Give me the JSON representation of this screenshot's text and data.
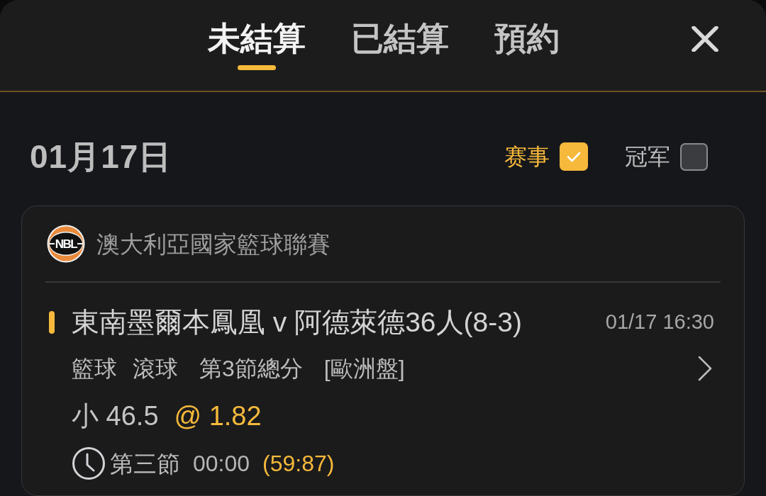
{
  "tabs": [
    {
      "label": "未結算",
      "selected": true
    },
    {
      "label": "已結算",
      "selected": false
    },
    {
      "label": "預約",
      "selected": false
    }
  ],
  "date_header": {
    "date": "01月17日",
    "filters": [
      {
        "label": "赛事",
        "checked": true
      },
      {
        "label": "冠军",
        "checked": false
      }
    ]
  },
  "bet_card": {
    "league": {
      "logo_text": "NBL",
      "name": "澳大利亞國家籃球聯賽"
    },
    "match": "東南墨爾本鳳凰 v 阿德萊德36人(8-3)",
    "time": "01/17 16:30",
    "details": [
      "籃球",
      "滾球",
      "第3節總分",
      "[歐洲盤]"
    ],
    "selection": "小 46.5",
    "odds": "@ 1.82",
    "period": "第三節",
    "clock": "00:00",
    "score": "(59:87)"
  }
}
